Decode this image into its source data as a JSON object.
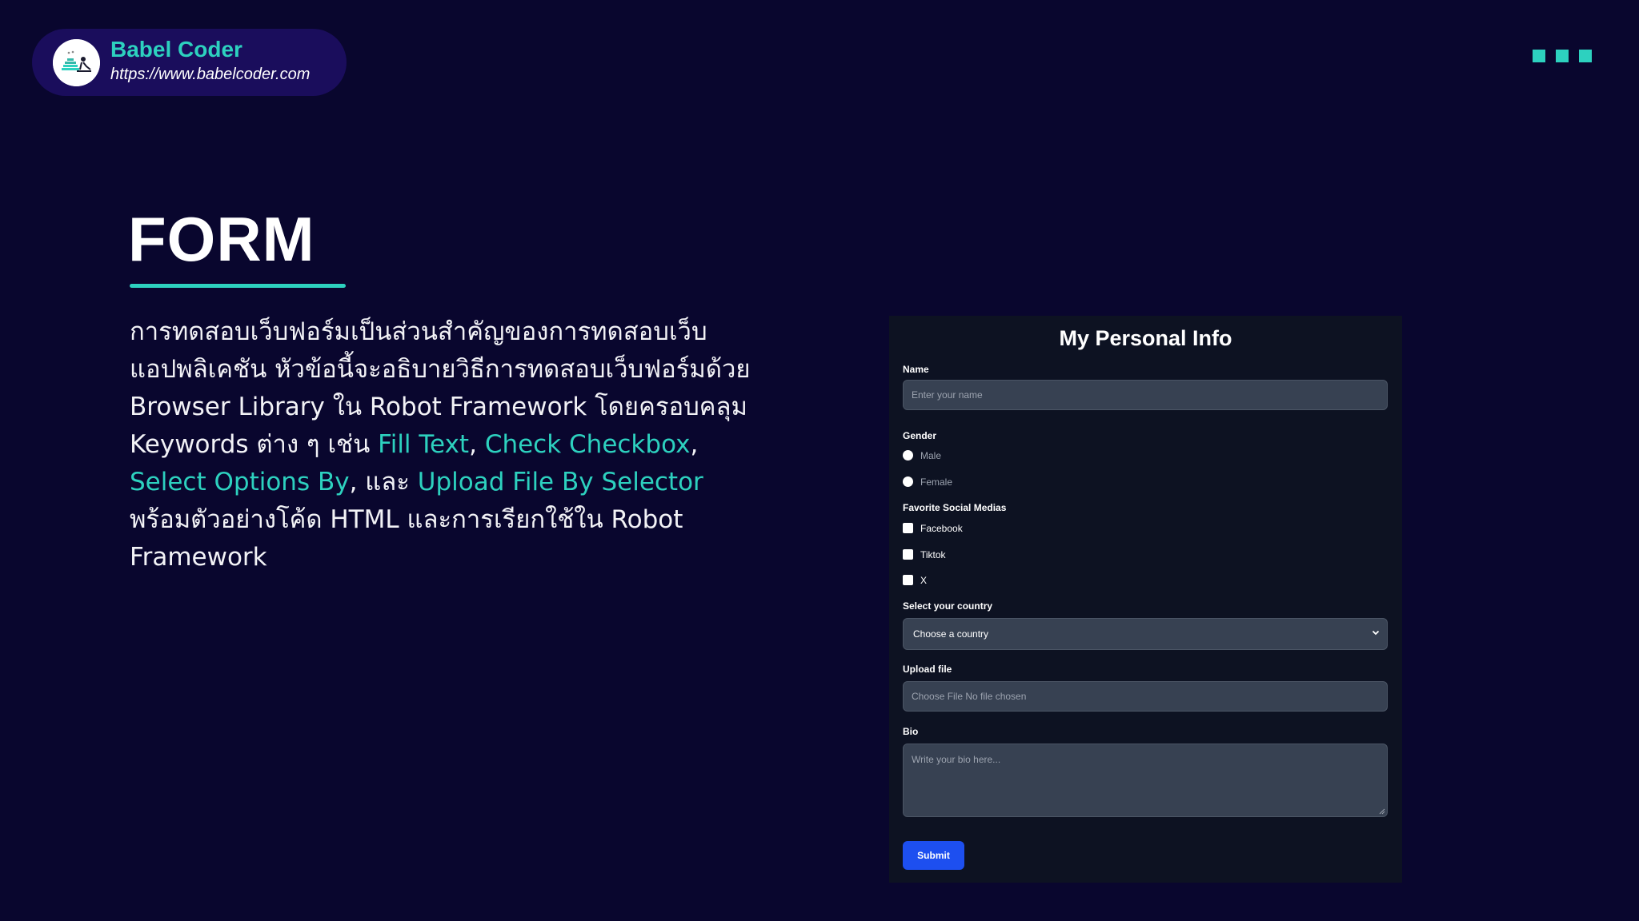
{
  "brand": {
    "name": "Babel Coder",
    "url": "https://www.babelcoder.com"
  },
  "slide": {
    "title": "FORM",
    "description": {
      "line1": "การทดสอบเว็บฟอร์มเป็นส่วนสำคัญของการทดสอบเว็บ",
      "line2": "แอปพลิเคชัน หัวข้อนี้จะอธิบายวิธีการทดสอบเว็บฟอร์มด้วย",
      "line3": "Browser Library ใน Robot Framework โดยครอบคลุม",
      "line4_prefix": "Keywords ต่าง ๆ เช่น ",
      "kw_fill_text": "Fill Text",
      "sep_comma_1": ", ",
      "kw_check_checkbox": "Check Checkbox",
      "sep_comma_2": ",",
      "kw_select_options": "Select Options By",
      "sep_and": ", และ ",
      "kw_upload_file": "Upload File By Selector",
      "line6": "พร้อมตัวอย่างโค้ด HTML และการเรียกใช้ใน Robot",
      "line7": "Framework"
    }
  },
  "form": {
    "title": "My Personal Info",
    "name": {
      "label": "Name",
      "placeholder": "Enter your name"
    },
    "gender": {
      "label": "Gender",
      "options": [
        "Male",
        "Female"
      ]
    },
    "social": {
      "label": "Favorite Social Medias",
      "options": [
        "Facebook",
        "Tiktok",
        "X"
      ]
    },
    "country": {
      "label": "Select your country",
      "selected": "Choose a country"
    },
    "upload": {
      "label": "Upload file",
      "text": "Choose File No file chosen"
    },
    "bio": {
      "label": "Bio",
      "placeholder": "Write your bio here..."
    },
    "submit_label": "Submit"
  },
  "colors": {
    "background": "#09062e",
    "accent": "#2dd1bf",
    "panel": "#0d1222",
    "input": "#374152",
    "submit": "#1d4ff0"
  }
}
